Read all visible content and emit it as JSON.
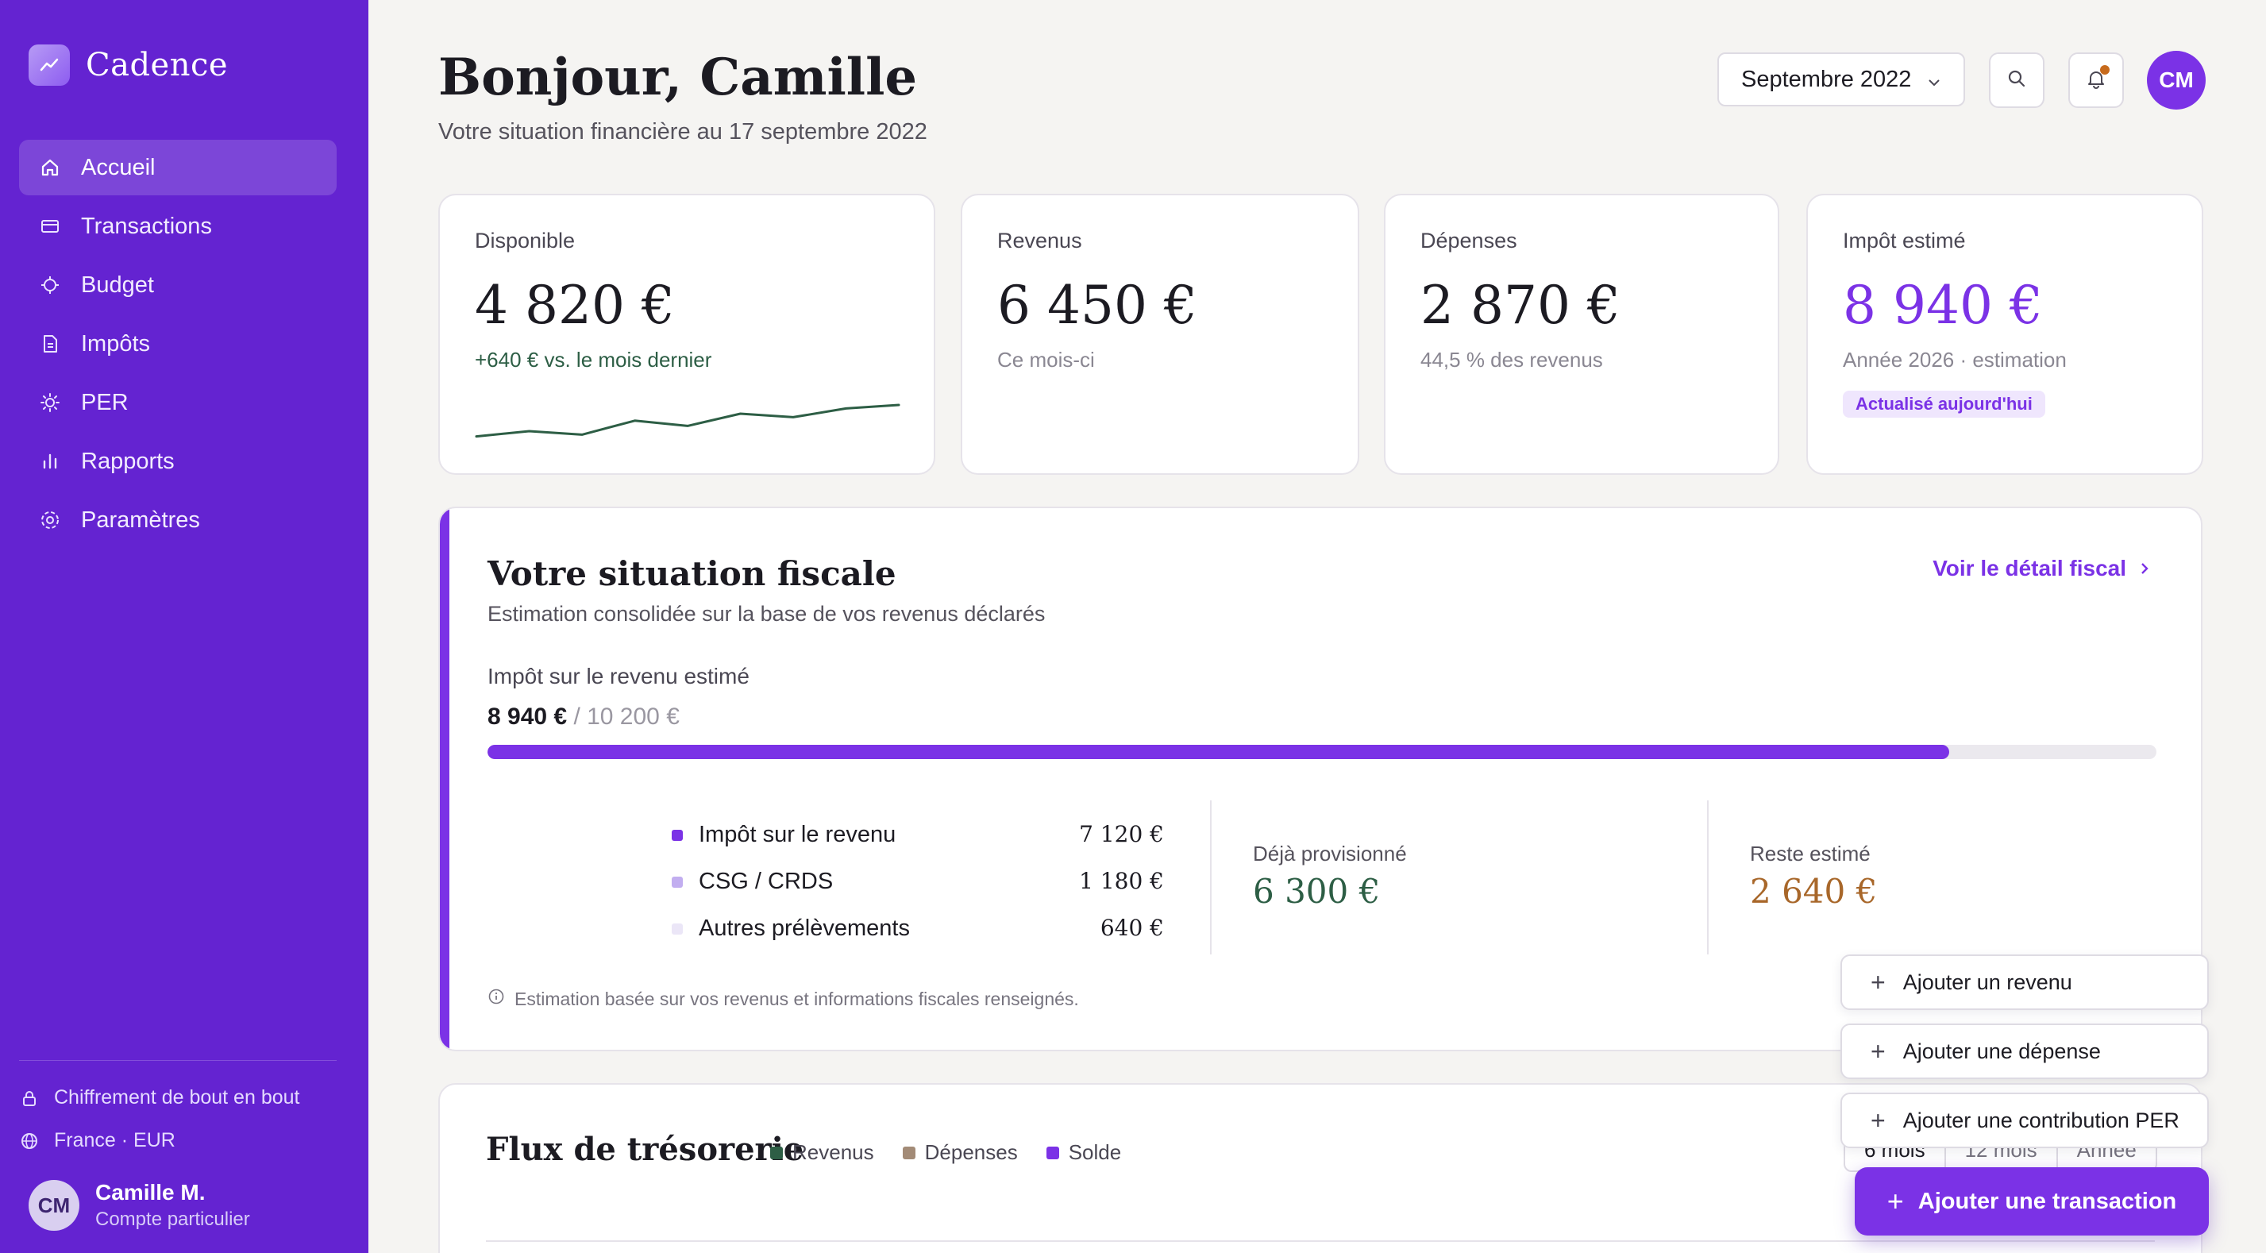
{
  "brand": {
    "name": "Cadence",
    "logo_icon": "chart-trend-icon"
  },
  "sidebar": {
    "items": [
      {
        "label": "Accueil",
        "icon": "home-icon",
        "active": true
      },
      {
        "label": "Transactions",
        "icon": "card-icon",
        "active": false
      },
      {
        "label": "Budget",
        "icon": "target-icon",
        "active": false
      },
      {
        "label": "Impôts",
        "icon": "document-icon",
        "active": false
      },
      {
        "label": "PER",
        "icon": "sun-icon",
        "active": false
      },
      {
        "label": "Rapports",
        "icon": "bar-chart-icon",
        "active": false
      },
      {
        "label": "Paramètres",
        "icon": "gear-icon",
        "active": false
      }
    ],
    "security": "Chiffrement de bout en bout",
    "locale": "France · EUR",
    "user": {
      "initials": "CM",
      "name": "Camille M.",
      "account": "Compte particulier"
    }
  },
  "header": {
    "greeting": "Bonjour, Camille",
    "subtitle": "Votre situation financière au 17 septembre 2022",
    "month": "Septembre 2022",
    "avatar_initials": "CM"
  },
  "stats": {
    "disponible": {
      "label": "Disponible",
      "value": "4 820 €",
      "note": "+640 € vs. le mois dernier",
      "sparkline": [
        0.1,
        0.25,
        0.15,
        0.55,
        0.4,
        0.75,
        0.65,
        0.9,
        1.0
      ]
    },
    "revenus": {
      "label": "Revenus",
      "value": "6 450 €",
      "note": "Ce mois-ci"
    },
    "depenses": {
      "label": "Dépenses",
      "value": "2 870 €",
      "note": "44,5 % des revenus"
    },
    "impot": {
      "label": "Impôt estimé",
      "value": "8 940 €",
      "note": "Année 2026 · estimation",
      "badge": "Actualisé aujourd'hui"
    }
  },
  "fiscal": {
    "title": "Votre situation fiscale",
    "subtitle": "Estimation consolidée sur la base de vos revenus déclarés",
    "link": "Voir le détail fiscal",
    "tax_label": "Impôt sur le revenu estimé",
    "tax_current": "8 940 €",
    "tax_total": "/ 10 200 €",
    "progress": 0.876,
    "breakdown": [
      {
        "label": "Impôt sur le revenu",
        "value": "7 120 €",
        "color": "#7b32e6"
      },
      {
        "label": "CSG / CRDS",
        "value": "1 180 €",
        "color": "#c2aef0"
      },
      {
        "label": "Autres prélèvements",
        "value": "640 €",
        "color": "#ebe6f7"
      }
    ],
    "provisioned_label": "Déjà provisionné",
    "provisioned_value": "6 300 €",
    "remaining_label": "Reste estimé",
    "remaining_value": "2 640 €",
    "footnote": "Estimation basée sur vos revenus et informations fiscales renseignés."
  },
  "cashflow": {
    "title": "Flux de trésorerie",
    "legend": [
      {
        "label": "Revenus",
        "color": "#2d5e45"
      },
      {
        "label": "Dépenses",
        "color": "#a38b77"
      },
      {
        "label": "Solde",
        "color": "#7b32e6"
      }
    ],
    "ranges": [
      "6 mois",
      "12 mois",
      "Année"
    ]
  },
  "quick_actions": [
    "Ajouter un revenu",
    "Ajouter une dépense",
    "Ajouter une contribution PER"
  ],
  "fab_label": "Ajouter une transaction",
  "colors": {
    "primary": "#7b32e6",
    "sidebar": "#6423d1",
    "positive": "#2d5e45",
    "warning": "#a8672a"
  }
}
